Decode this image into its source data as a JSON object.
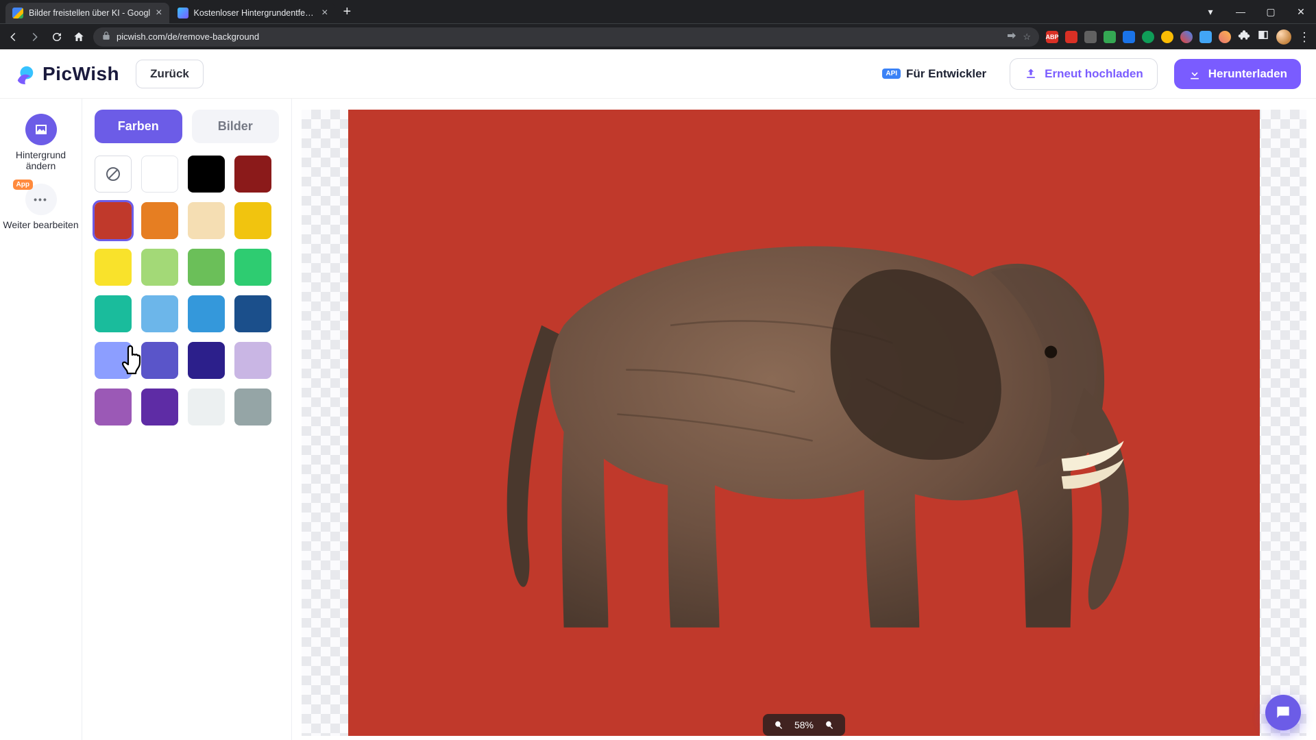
{
  "browser": {
    "tabs": [
      {
        "title": "Bilder freistellen über KI - Googl",
        "active": false
      },
      {
        "title": "Kostenloser Hintergrundentferne",
        "active": true
      }
    ],
    "url": "picwish.com/de/remove-background",
    "extensions": {
      "abp": "ABP"
    }
  },
  "header": {
    "brand": "PicWish",
    "back": "Zurück",
    "dev": "Für Entwickler",
    "reupload": "Erneut hochladen",
    "download": "Herunterladen"
  },
  "rail": {
    "change_bg": "Hintergrund ändern",
    "app_badge": "App",
    "more_edit": "Weiter bearbeiten"
  },
  "panel": {
    "tab_colors": "Farben",
    "tab_images": "Bilder",
    "colors": [
      "none",
      "#ffffff",
      "#000000",
      "#8b1a1a",
      "#c0392b",
      "#e67e22",
      "#f5deb3",
      "#f1c40f",
      "#f9e22b",
      "#a3d977",
      "#6bbf59",
      "#2ecc71",
      "#1abc9c",
      "#6cb6ea",
      "#3498db",
      "#1b4f8b",
      "#8c9eff",
      "#5a55c9",
      "#2c1f8b",
      "#c9b6e4",
      "#9b59b6",
      "#5e2ca5",
      "#ecf0f1",
      "#95a5a6"
    ],
    "selected_index": 4
  },
  "canvas": {
    "bg_color": "#c0392b",
    "zoom": "58%"
  }
}
